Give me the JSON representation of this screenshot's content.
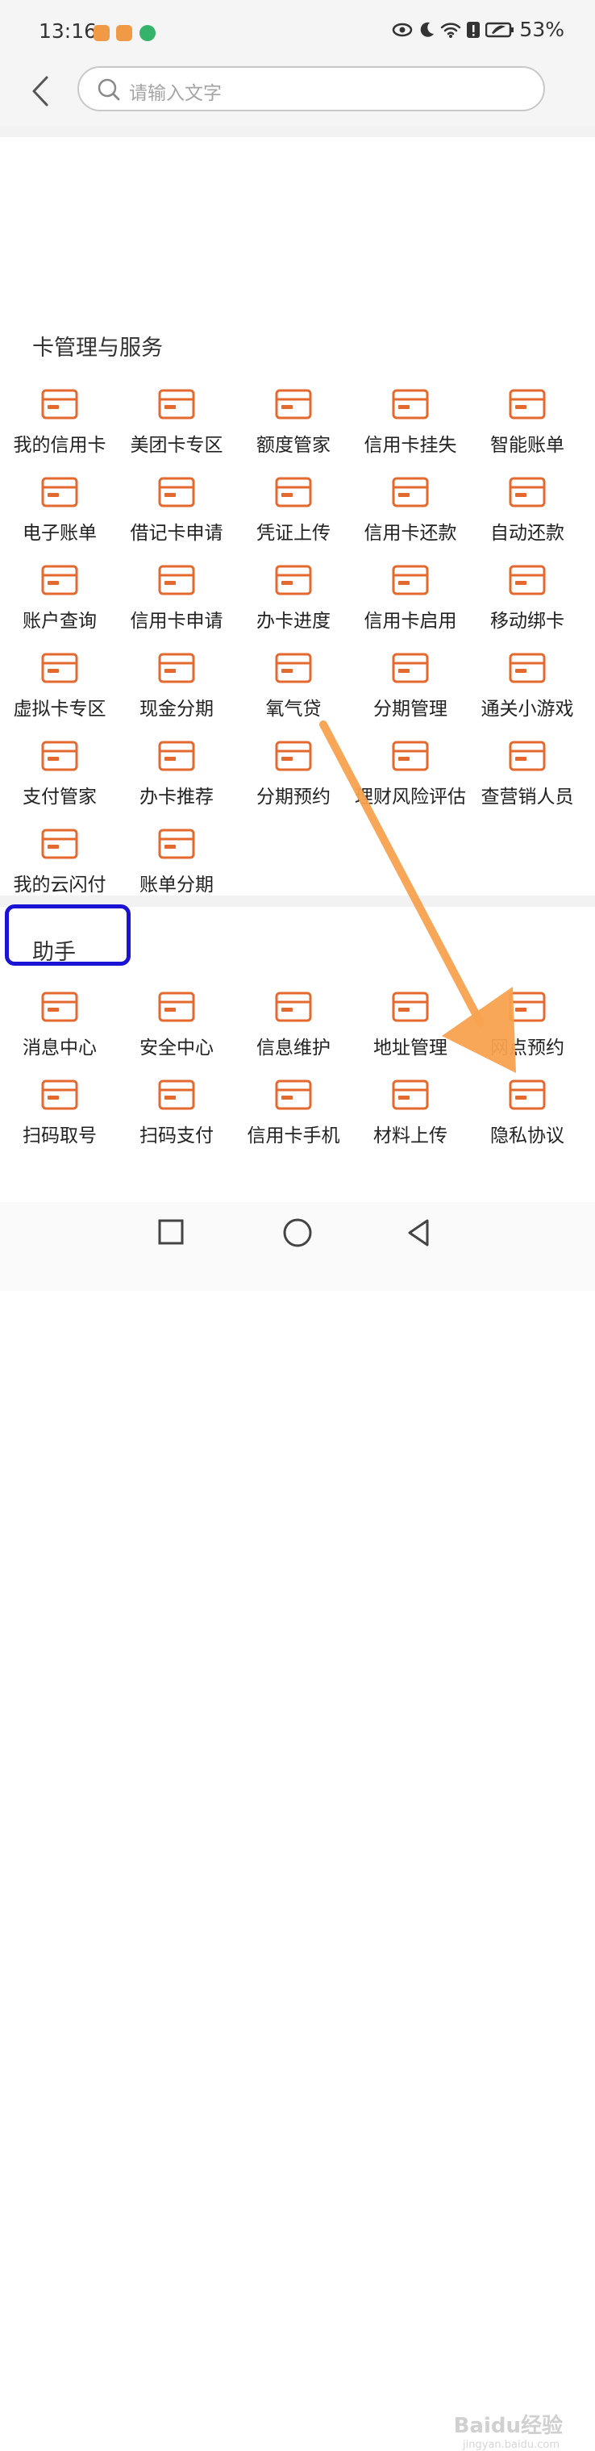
{
  "status_bar": {
    "time": "13:16",
    "battery": "53%"
  },
  "header": {
    "back_label": "",
    "search_placeholder": "请输入文字"
  },
  "section_card": {
    "title": "卡管理与服务",
    "items": [
      {
        "label": "我的信用卡",
        "icon": "credit-card-icon"
      },
      {
        "label": "美团卡专区",
        "icon": "meituan-card-icon"
      },
      {
        "label": "额度管家",
        "icon": "quota-shield-icon"
      },
      {
        "label": "信用卡挂失",
        "icon": "card-lock-icon"
      },
      {
        "label": "智能账单",
        "icon": "smart-bill-icon"
      },
      {
        "label": "电子账单",
        "icon": "e-bill-icon"
      },
      {
        "label": "借记卡申请",
        "icon": "debit-card-apply-icon"
      },
      {
        "label": "凭证上传",
        "icon": "upload-cycle-icon"
      },
      {
        "label": "信用卡还款",
        "icon": "card-repay-icon"
      },
      {
        "label": "自动还款",
        "icon": "auto-repay-icon"
      },
      {
        "label": "账户查询",
        "icon": "account-query-icon"
      },
      {
        "label": "信用卡申请",
        "icon": "credit-card-apply-icon"
      },
      {
        "label": "办卡进度",
        "icon": "card-progress-icon"
      },
      {
        "label": "信用卡启用",
        "icon": "card-activate-icon"
      },
      {
        "label": "移动绑卡",
        "icon": "card-bind-icon"
      },
      {
        "label": "虚拟卡专区",
        "icon": "virtual-card-icon"
      },
      {
        "label": "现金分期",
        "icon": "cash-installment-icon"
      },
      {
        "label": "氧气贷",
        "icon": "oxygen-loan-icon"
      },
      {
        "label": "分期管理",
        "icon": "installment-manage-icon"
      },
      {
        "label": "通关小游戏",
        "icon": "game-icon"
      },
      {
        "label": "支付管家",
        "icon": "payment-manager-icon"
      },
      {
        "label": "办卡推荐",
        "icon": "mgm-icon"
      },
      {
        "label": "分期预约",
        "icon": "installment-booking-icon"
      },
      {
        "label": "理财风险评估",
        "icon": "risk-assessment-icon"
      },
      {
        "label": "查营销人员",
        "icon": "sales-query-icon"
      },
      {
        "label": "我的云闪付",
        "icon": "cloud-pay-icon"
      },
      {
        "label": "账单分期",
        "icon": "bill-installment-icon"
      }
    ]
  },
  "section_assistant": {
    "title": "助手",
    "items": [
      {
        "label": "消息中心",
        "icon": "message-icon"
      },
      {
        "label": "安全中心",
        "icon": "security-shield-icon"
      },
      {
        "label": "信息维护",
        "icon": "info-edit-icon"
      },
      {
        "label": "地址管理",
        "icon": "address-icon"
      },
      {
        "label": "网点预约",
        "icon": "location-pin-icon"
      },
      {
        "label": "扫码取号",
        "icon": "scan-ticket-icon"
      },
      {
        "label": "扫码支付",
        "icon": "scan-pay-icon"
      },
      {
        "label": "信用卡手机",
        "icon": "card-phone-icon"
      },
      {
        "label": "材料上传",
        "icon": "material-upload-icon"
      },
      {
        "label": "隐私协议",
        "icon": "privacy-icon"
      }
    ]
  },
  "watermark": {
    "brand": "Baidu经验",
    "sub": "jingyan.baidu.com"
  },
  "colors": {
    "accent": "#e4692f",
    "highlight": "#1a13d6",
    "arrow": "#f8a24f"
  }
}
